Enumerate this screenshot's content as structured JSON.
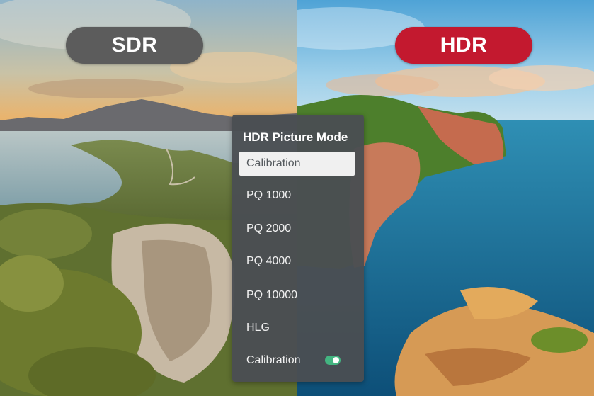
{
  "badges": {
    "sdr_label": "SDR",
    "hdr_label": "HDR"
  },
  "menu": {
    "title": "HDR Picture Mode",
    "items": [
      {
        "label": "Calibration",
        "selected": true
      },
      {
        "label": "PQ 1000",
        "selected": false
      },
      {
        "label": "PQ 2000",
        "selected": false
      },
      {
        "label": "PQ 4000",
        "selected": false
      },
      {
        "label": "PQ 10000",
        "selected": false
      },
      {
        "label": "HLG",
        "selected": false
      }
    ],
    "toggle": {
      "label": "Calibration",
      "on": true
    }
  },
  "colors": {
    "sdr_badge": "#5c5c5c",
    "hdr_badge": "#c3192f",
    "panel": "#4a4e52",
    "selected_row": "#f0f0f0",
    "toggle_on": "#43b581"
  },
  "icons": {
    "toggle": "toggle-switch-icon"
  }
}
